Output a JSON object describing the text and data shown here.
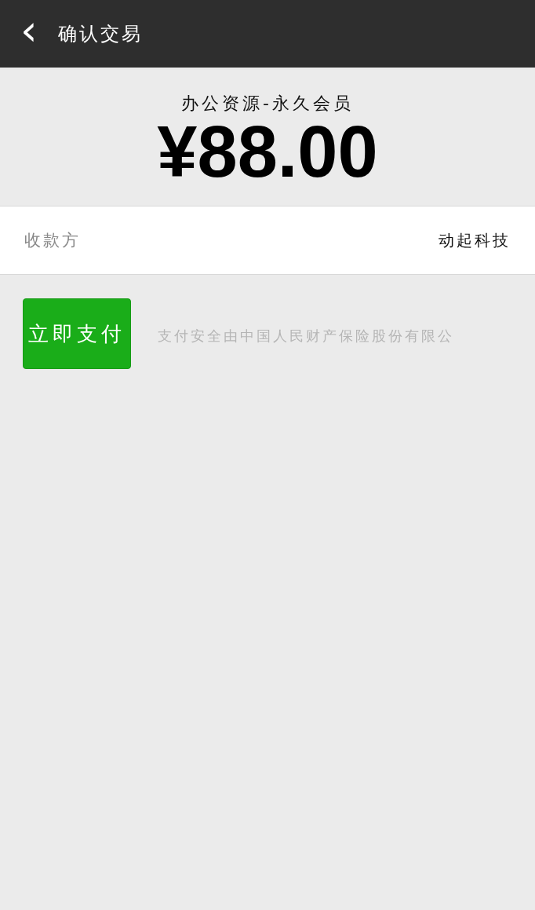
{
  "header": {
    "back_icon": "‹",
    "title": "确认交易"
  },
  "order": {
    "product": "办公资源-永久会员",
    "amount": "¥88.00"
  },
  "payee": {
    "label": "收款方",
    "value": "动起科技"
  },
  "pay_button": {
    "label": "立即支付"
  },
  "footer": "支付安全由中国人民财产保险股份有限公"
}
